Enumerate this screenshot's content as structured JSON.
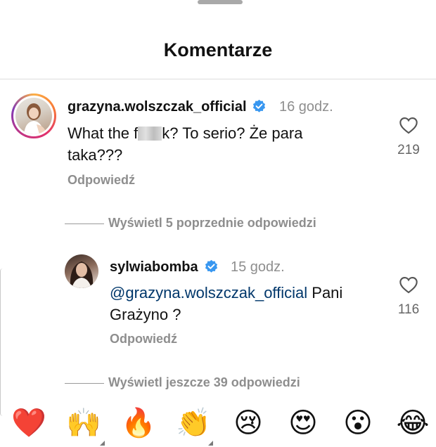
{
  "header": {
    "title": "Komentarze"
  },
  "comments": [
    {
      "username": "grazyna.wolszczak_official",
      "time": "16 godz.",
      "text_part1": "What the f",
      "text_part2": "k? To serio? Że para",
      "text_line2": "taka???",
      "likes": "219",
      "reply_label": "Odpowiedź"
    }
  ],
  "view_previous": "Wyświetl 5 poprzednie odpowiedzi",
  "replies": [
    {
      "username": "sylwiabomba",
      "time": "15 godz.",
      "mention": "@grazyna.wolszczak_official",
      "text_line1_rest": " Pani",
      "text_line2": "Grażyno ?",
      "likes": "116",
      "reply_label": "Odpowiedź"
    }
  ],
  "view_more": "Wyświetl jeszcze 39 odpowiedzi",
  "emoji_reactions": [
    "❤️",
    "🙌",
    "🔥",
    "👏",
    "😢",
    "😍",
    "😮",
    "😂"
  ],
  "colors": {
    "verified": "#3897f0",
    "mention": "#00376b",
    "muted": "#8e8e8e"
  }
}
